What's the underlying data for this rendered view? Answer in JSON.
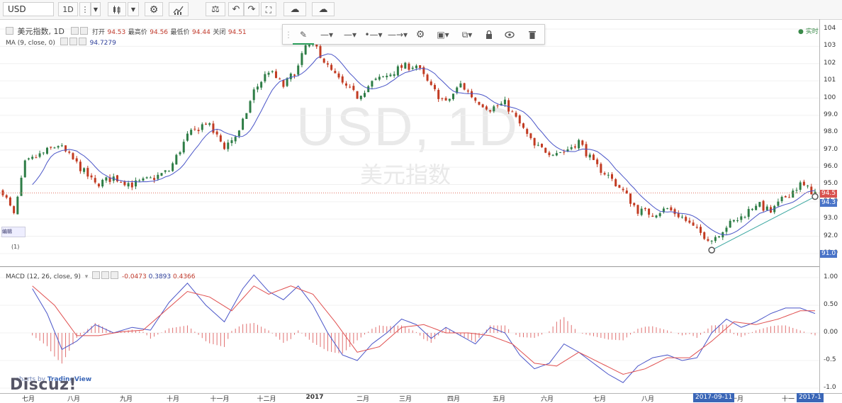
{
  "toolbar": {
    "symbol": "USD",
    "interval": "1D",
    "icons": [
      "three-dots-icon",
      "chevron-down-icon",
      "candles-icon",
      "chevron-down-icon",
      "gear-icon",
      "indicators-icon",
      "scale-icon",
      "undo-icon",
      "redo-icon",
      "fullscreen-icon",
      "cloud-save-icon",
      "cloud-upload-icon"
    ]
  },
  "drawing_toolbar": {
    "icons": [
      "pencil-icon",
      "line-style-icon",
      "line-width-icon",
      "line-end-icon",
      "arrow-line-icon",
      "gear-icon",
      "bring-front-icon",
      "clone-icon",
      "lock-icon",
      "eye-icon",
      "trash-icon"
    ]
  },
  "legend": {
    "main": "美元指数, 1D",
    "open_label": "打开",
    "open_value": "94.53",
    "high_label": "最高价",
    "high_value": "94.56",
    "low_label": "最低价",
    "low_value": "94.44",
    "close_label": "关闭",
    "close_value": "94.51",
    "ma": "MA (9, close, 0)",
    "ma_value": "94.7279",
    "macd": "MACD (12, 26, close, 9)",
    "macd_v1": "-0.0473",
    "macd_v2": "0.3893",
    "macd_v3": "0.4366",
    "realtime": "实时",
    "left_tag": "编辑",
    "left_marker": "(1)"
  },
  "watermark": {
    "symbol": "USD, 1D",
    "name": "美元指数"
  },
  "price_tags": {
    "last": "94.5",
    "ma": "94.3",
    "line": "91.0"
  },
  "x_labels": [
    "七月",
    "八月",
    "九月",
    "十月",
    "十一月",
    "十二月",
    "2017",
    "二月",
    "三月",
    "四月",
    "五月",
    "六月",
    "七月",
    "八月",
    "十月",
    "十一"
  ],
  "x_highlight": {
    "date1": "2017-09-11",
    "date2": "2017-1"
  },
  "credit": {
    "prefix": "charts by ",
    "brand": "TradingView",
    "forum": "Discuz!"
  },
  "colors": {
    "up": "#2e7d46",
    "down": "#c23b22",
    "ma": "#4a55c8",
    "macd": "#4a55c8",
    "signal": "#e05050",
    "hist": "#e07070",
    "trendline": "#3aa7a0"
  },
  "chart_data": [
    {
      "type": "candlestick",
      "title": "美元指数, 1D",
      "y_ticks": [
        "104",
        "103",
        "102",
        "101",
        "100",
        "99.0",
        "98.0",
        "97.0",
        "96.0",
        "95.0",
        "94.0",
        "93.0",
        "92.0",
        "91.0"
      ],
      "ylim": [
        91.0,
        104.0
      ],
      "close_path": [
        [
          0,
          94.6
        ],
        [
          3,
          93.2
        ],
        [
          6,
          96.2
        ],
        [
          10,
          96.7
        ],
        [
          15,
          97.3
        ],
        [
          20,
          96.2
        ],
        [
          25,
          95.0
        ],
        [
          30,
          95.4
        ],
        [
          35,
          95.0
        ],
        [
          40,
          95.3
        ],
        [
          45,
          95.8
        ],
        [
          50,
          97.8
        ],
        [
          55,
          98.6
        ],
        [
          60,
          97.2
        ],
        [
          64,
          98.0
        ],
        [
          68,
          100.4
        ],
        [
          72,
          101.6
        ],
        [
          76,
          100.7
        ],
        [
          80,
          101.8
        ],
        [
          82,
          103.0
        ],
        [
          85,
          102.9
        ],
        [
          88,
          101.8
        ],
        [
          92,
          100.8
        ],
        [
          96,
          100.1
        ],
        [
          100,
          100.9
        ],
        [
          104,
          101.3
        ],
        [
          108,
          101.8
        ],
        [
          112,
          101.9
        ],
        [
          116,
          100.6
        ],
        [
          120,
          99.7
        ],
        [
          124,
          100.8
        ],
        [
          128,
          99.9
        ],
        [
          132,
          99.4
        ],
        [
          136,
          99.7
        ],
        [
          140,
          98.5
        ],
        [
          144,
          97.2
        ],
        [
          148,
          96.9
        ],
        [
          152,
          96.9
        ],
        [
          156,
          97.5
        ],
        [
          160,
          96.2
        ],
        [
          164,
          95.5
        ],
        [
          168,
          94.6
        ],
        [
          172,
          93.5
        ],
        [
          176,
          93.3
        ],
        [
          180,
          93.6
        ],
        [
          184,
          93.1
        ],
        [
          188,
          92.3
        ],
        [
          192,
          91.8
        ],
        [
          196,
          92.6
        ],
        [
          200,
          93.1
        ],
        [
          204,
          93.9
        ],
        [
          208,
          93.4
        ],
        [
          212,
          94.3
        ],
        [
          216,
          95.0
        ],
        [
          220,
          94.5
        ]
      ],
      "ma_length": 9,
      "trendline": {
        "from": [
          192,
          91.2
        ],
        "to": [
          220,
          94.3
        ]
      }
    },
    {
      "type": "macd",
      "title": "MACD (12, 26, close, 9)",
      "y_ticks": [
        "1.00",
        "0.50",
        "0.00",
        "-0.5",
        "-1.0"
      ],
      "ylim": [
        -1.0,
        1.0
      ],
      "macd_path": [
        [
          8,
          0.8
        ],
        [
          12,
          0.35
        ],
        [
          16,
          -0.3
        ],
        [
          20,
          -0.15
        ],
        [
          25,
          0.15
        ],
        [
          30,
          0.0
        ],
        [
          35,
          0.1
        ],
        [
          40,
          0.05
        ],
        [
          45,
          0.55
        ],
        [
          50,
          0.9
        ],
        [
          55,
          0.5
        ],
        [
          60,
          0.2
        ],
        [
          65,
          0.8
        ],
        [
          68,
          1.05
        ],
        [
          72,
          0.75
        ],
        [
          76,
          0.6
        ],
        [
          80,
          0.85
        ],
        [
          84,
          0.5
        ],
        [
          88,
          0.0
        ],
        [
          92,
          -0.4
        ],
        [
          96,
          -0.5
        ],
        [
          100,
          -0.2
        ],
        [
          104,
          0.0
        ],
        [
          108,
          0.25
        ],
        [
          112,
          0.15
        ],
        [
          116,
          -0.1
        ],
        [
          120,
          0.1
        ],
        [
          124,
          -0.05
        ],
        [
          128,
          -0.2
        ],
        [
          132,
          0.1
        ],
        [
          136,
          0.0
        ],
        [
          140,
          -0.4
        ],
        [
          144,
          -0.65
        ],
        [
          148,
          -0.55
        ],
        [
          152,
          -0.2
        ],
        [
          156,
          -0.35
        ],
        [
          160,
          -0.55
        ],
        [
          164,
          -0.75
        ],
        [
          168,
          -0.9
        ],
        [
          172,
          -0.6
        ],
        [
          176,
          -0.45
        ],
        [
          180,
          -0.4
        ],
        [
          184,
          -0.5
        ],
        [
          188,
          -0.45
        ],
        [
          192,
          0.0
        ],
        [
          196,
          0.25
        ],
        [
          200,
          0.1
        ],
        [
          204,
          0.2
        ],
        [
          208,
          0.35
        ],
        [
          212,
          0.45
        ],
        [
          216,
          0.45
        ],
        [
          220,
          0.35
        ]
      ],
      "signal_path": [
        [
          8,
          0.85
        ],
        [
          14,
          0.5
        ],
        [
          20,
          -0.05
        ],
        [
          26,
          -0.05
        ],
        [
          32,
          0.02
        ],
        [
          38,
          0.05
        ],
        [
          44,
          0.4
        ],
        [
          50,
          0.75
        ],
        [
          56,
          0.65
        ],
        [
          62,
          0.4
        ],
        [
          68,
          0.85
        ],
        [
          72,
          0.7
        ],
        [
          78,
          0.85
        ],
        [
          84,
          0.7
        ],
        [
          90,
          0.2
        ],
        [
          96,
          -0.35
        ],
        [
          102,
          -0.25
        ],
        [
          108,
          0.1
        ],
        [
          114,
          0.15
        ],
        [
          120,
          0.0
        ],
        [
          126,
          0.0
        ],
        [
          132,
          -0.05
        ],
        [
          138,
          -0.2
        ],
        [
          144,
          -0.55
        ],
        [
          150,
          -0.6
        ],
        [
          156,
          -0.35
        ],
        [
          162,
          -0.55
        ],
        [
          168,
          -0.75
        ],
        [
          174,
          -0.65
        ],
        [
          180,
          -0.45
        ],
        [
          186,
          -0.45
        ],
        [
          192,
          -0.15
        ],
        [
          198,
          0.2
        ],
        [
          204,
          0.15
        ],
        [
          210,
          0.25
        ],
        [
          216,
          0.4
        ],
        [
          220,
          0.4
        ]
      ]
    }
  ]
}
